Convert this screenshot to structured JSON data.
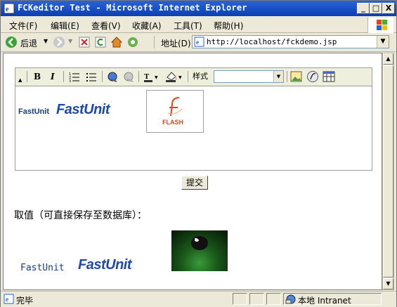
{
  "window": {
    "title": "FCKeditor Test - Microsoft Internet Explorer"
  },
  "controls": {
    "min": "_",
    "max": "□",
    "close": "X"
  },
  "menubar": [
    {
      "label": "文件(F)"
    },
    {
      "label": "编辑(E)"
    },
    {
      "label": "查看(V)"
    },
    {
      "label": "收藏(A)"
    },
    {
      "label": "工具(T)"
    },
    {
      "label": "帮助(H)"
    }
  ],
  "toolbar": {
    "back_label": "后退",
    "address_label": "地址(D)",
    "address_value": "http://localhost/fckdemo.jsp"
  },
  "editor": {
    "style_label": "样式",
    "style_value": "",
    "content_small": "FastUnit",
    "content_logo": "FastUnit",
    "flash_text": "FLASH",
    "bold": "B",
    "italic": "I"
  },
  "page": {
    "submit_label": "提交",
    "result_label": "取值（可直接保存至数据库）：",
    "result_small": "FastUnit",
    "result_logo": "FastUnit"
  },
  "status": {
    "text": "完毕",
    "zone": "本地 Intranet"
  },
  "colors": {
    "title_bar": "#0a3fb6",
    "brand_blue": "#1f4aa8",
    "flash_red": "#e2461c"
  }
}
